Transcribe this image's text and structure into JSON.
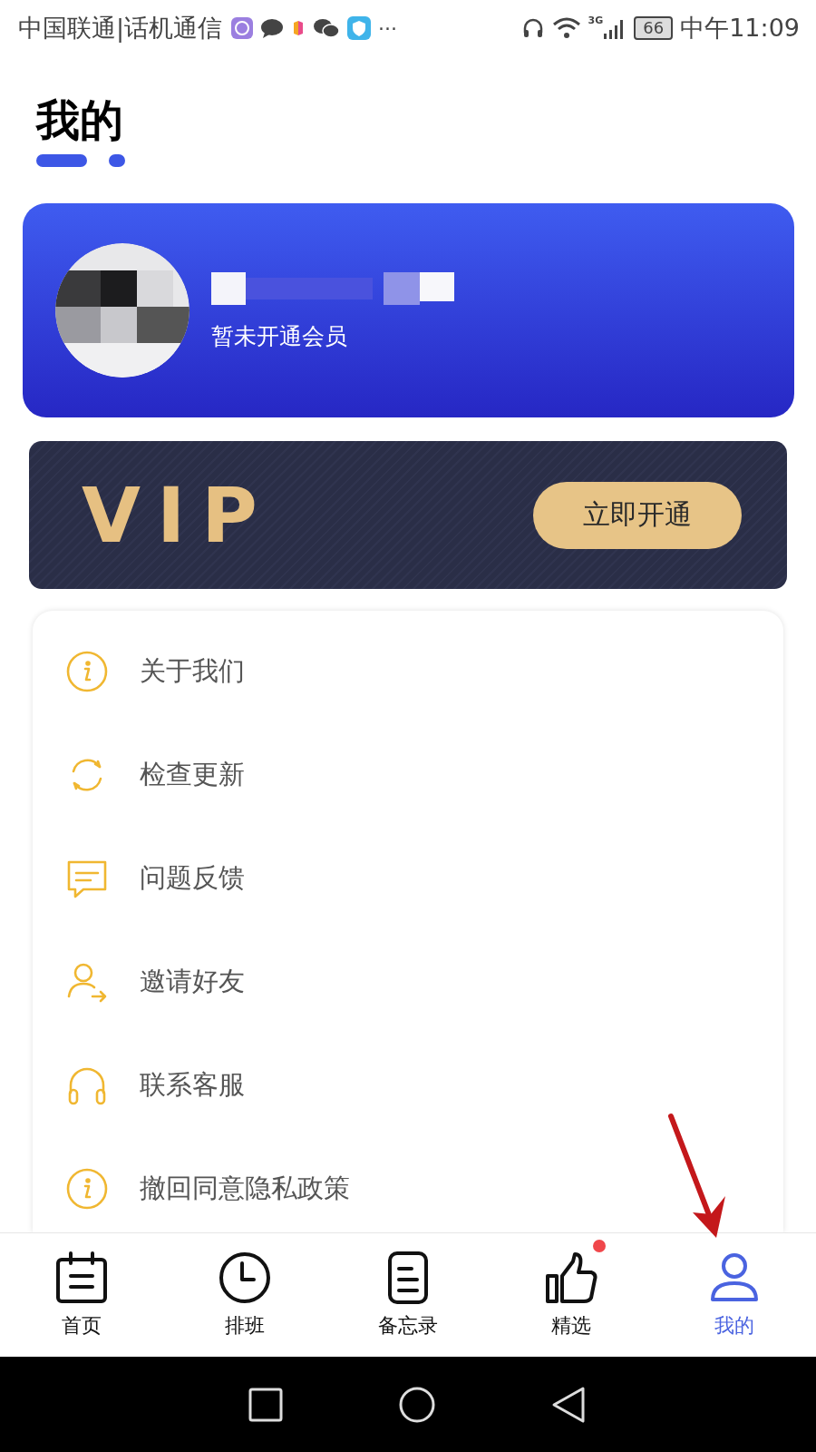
{
  "status_bar": {
    "carrier": "中国联通|话机通信",
    "more": "···",
    "network": "3G",
    "battery": "66",
    "time": "中午11:09"
  },
  "page_title": "我的",
  "profile": {
    "membership": "暂未开通会员"
  },
  "vip_banner": {
    "logo": "VIP",
    "button": "立即开通"
  },
  "menu": [
    {
      "label": "关于我们"
    },
    {
      "label": "检查更新"
    },
    {
      "label": "问题反馈"
    },
    {
      "label": "邀请好友"
    },
    {
      "label": "联系客服"
    },
    {
      "label": "撤回同意隐私政策"
    }
  ],
  "tab_bar": [
    {
      "label": "首页",
      "selected": false,
      "badge": false
    },
    {
      "label": "排班",
      "selected": false,
      "badge": false
    },
    {
      "label": "备忘录",
      "selected": false,
      "badge": false
    },
    {
      "label": "精选",
      "selected": false,
      "badge": true
    },
    {
      "label": "我的",
      "selected": true,
      "badge": false
    }
  ],
  "annotation": {
    "kind": "arrow"
  }
}
